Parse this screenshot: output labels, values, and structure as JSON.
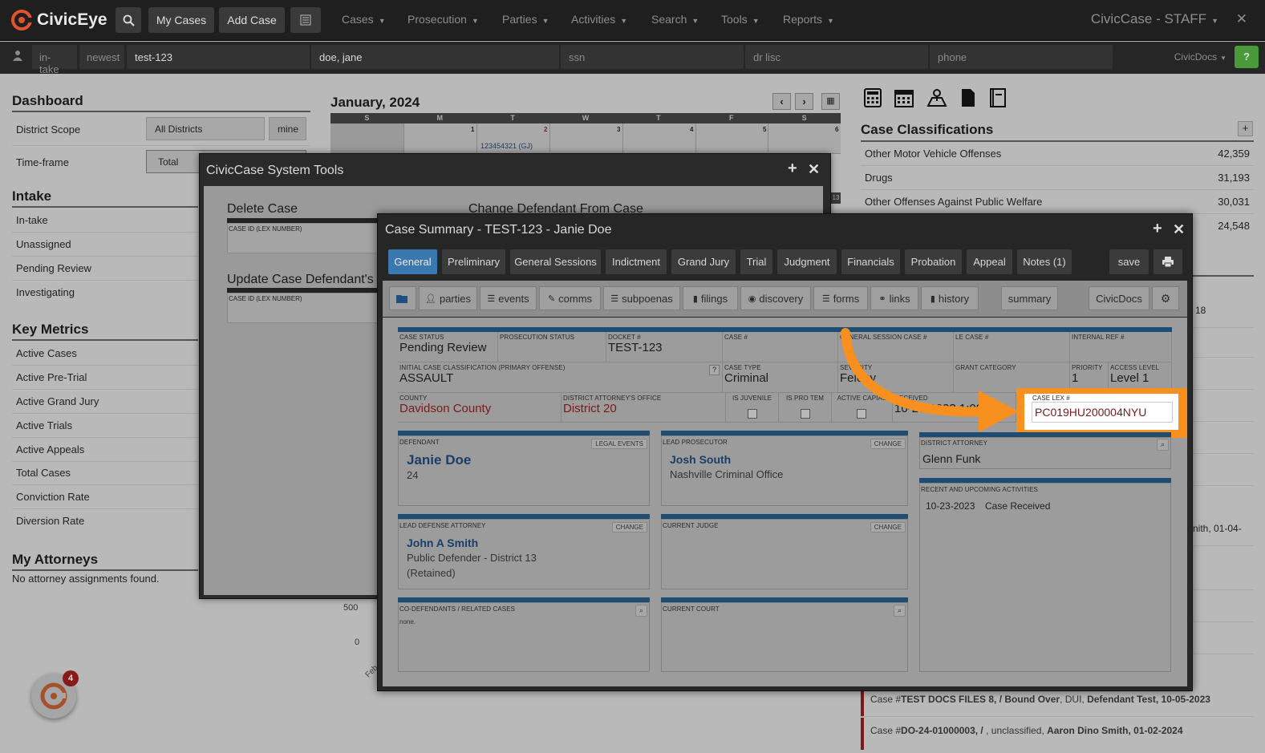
{
  "topnav": {
    "logo": "CivicEye",
    "my_cases": "My Cases",
    "add_case": "Add Case",
    "menus": [
      "Cases",
      "Prosecution",
      "Parties",
      "Activities",
      "Search",
      "Tools",
      "Reports"
    ],
    "brand": "CivicCase - STAFF",
    "close": "✕"
  },
  "searchbar": {
    "intake": "in-take",
    "newest": "newest",
    "case_value": "test-123",
    "name_value": "doe, jane",
    "ssn_placeholder": "ssn",
    "drlisc_placeholder": "dr lisc",
    "phone_placeholder": "phone",
    "civicdocs": "CivicDocs",
    "help": "?"
  },
  "dashboard": {
    "title": "Dashboard",
    "district_scope_label": "District Scope",
    "district_scope_value": "All Districts",
    "mine": "mine",
    "timeframe_label": "Time-frame",
    "timeframe_value": "Total",
    "intake_title": "Intake",
    "intake_items": [
      "In-take",
      "Unassigned",
      "Pending Review",
      "Investigating"
    ],
    "metrics_title": "Key Metrics",
    "metrics_items": [
      "Active Cases",
      "Active Pre-Trial",
      "Active Grand Jury",
      "Active Trials",
      "Active Appeals",
      "Total Cases",
      "Conviction Rate",
      "Diversion Rate"
    ],
    "attorneys_title": "My Attorneys",
    "attorneys_empty": "No attorney assignments found.",
    "notification_count": "4"
  },
  "calendar": {
    "month": "January, 2024",
    "days": [
      "S",
      "M",
      "T",
      "W",
      "T",
      "F",
      "S"
    ],
    "dates": [
      "1",
      "2",
      "3",
      "4",
      "5",
      "6"
    ],
    "event": "123454321 (GJ)",
    "side_date": "13",
    "chart_ticks": [
      "500",
      "0"
    ],
    "chart_xlabel": "Feb"
  },
  "classifications": {
    "title": "Case Classifications",
    "items": [
      {
        "label": "Other Motor Vehicle Offenses",
        "count": "42,359"
      },
      {
        "label": "Drugs",
        "count": "31,193"
      },
      {
        "label": "Other Offenses Against Public Welfare",
        "count": "30,031"
      },
      {
        "label": "",
        "count": "24,548"
      }
    ],
    "partial_number": "18",
    "partial_text": "nith, 01-04-"
  },
  "recent_cases": [
    {
      "prefix": "Case #",
      "id": "TEST DOCS FILES 8, / Bound Over",
      "middle": ", DUI, ",
      "name": "Defendant Test, 10-05-2023"
    },
    {
      "prefix": "Case #",
      "id": "DO-24-01000003, /",
      "middle": " , unclassified, ",
      "name": "Aaron Dino Smith, 01-02-2024"
    }
  ],
  "system_tools": {
    "title": "CivicCase System Tools",
    "delete_case": "Delete Case",
    "change_defendant": "Change Defendant From Case",
    "update_defendant": "Update Case Defendant's",
    "case_id_label": "CASE ID (LEX NUMBER)"
  },
  "case_summary": {
    "title": "Case Summary - TEST-123 - Janie Doe",
    "tabs": [
      "General",
      "Preliminary",
      "General Sessions",
      "Indictment",
      "Grand Jury",
      "Trial",
      "Judgment",
      "Financials",
      "Probation",
      "Appeal",
      "Notes (1)"
    ],
    "save": "save",
    "subtabs": [
      "parties",
      "events",
      "comms",
      "subpoenas",
      "filings",
      "discovery",
      "forms",
      "links",
      "history"
    ],
    "summary": "summary",
    "civicdocs": "CivicDocs",
    "fields": {
      "case_status_label": "CASE STATUS",
      "case_status": "Pending Review",
      "prosecution_status_label": "PROSECUTION STATUS",
      "docket_label": "DOCKET #",
      "docket": "TEST-123",
      "case_num_label": "CASE #",
      "general_session_label": "GENERAL SESSION CASE #",
      "le_case_label": "LE CASE #",
      "internal_ref_label": "INTERNAL REF #",
      "initial_class_label": "INITIAL CASE CLASSIFICATION (PRIMARY OFFENSE)",
      "initial_class": "ASSAULT",
      "help": "?",
      "case_type_label": "CASE TYPE",
      "case_type": "Criminal",
      "severity_label": "SEVERITY",
      "severity": "Felony",
      "grant_category_label": "GRANT CATEGORY",
      "priority_label": "PRIORITY",
      "priority": "1",
      "access_level_label": "ACCESS LEVEL",
      "access_level": "Level 1",
      "county_label": "COUNTY",
      "county": "Davidson County",
      "da_office_label": "DISTRICT ATTORNEY'S OFFICE",
      "da_office": "District 20",
      "is_juvenile_label": "IS JUVENILE",
      "is_pro_tem_label": "IS PRO TEM",
      "active_capias_label": "ACTIVE CAPIAS",
      "received_label": "RECEIVED",
      "received": "10-23-2023 1:00pm",
      "case_lex_label": "CASE LEX #",
      "case_lex": "PC019HU200004NYU"
    },
    "defendant": {
      "label": "DEFENDANT",
      "btn": "LEGAL EVENTS",
      "name": "Janie Doe",
      "age": "24"
    },
    "lead_prosecutor": {
      "label": "LEAD PROSECUTOR",
      "btn": "CHANGE",
      "name": "Josh South",
      "office": "Nashville Criminal Office"
    },
    "district_attorney": {
      "label": "DISTRICT ATTORNEY",
      "name": "Glenn Funk"
    },
    "defense": {
      "label": "LEAD DEFENSE ATTORNEY",
      "btn": "CHANGE",
      "name": "John A Smith",
      "office": "Public Defender - District 13",
      "note": "(Retained)"
    },
    "judge": {
      "label": "CURRENT JUDGE",
      "btn": "CHANGE"
    },
    "activities": {
      "label": "RECENT AND UPCOMING ACTIVITIES",
      "date": "10-23-2023",
      "text": "Case Received"
    },
    "codefendants": {
      "label": "CO-DEFENDANTS / RELATED CASES",
      "value": "none."
    },
    "court": {
      "label": "CURRENT COURT"
    }
  },
  "colors": {
    "accent": "#3a78b0",
    "highlight": "#f7901e",
    "header_bar": "#1e4c72",
    "link": "#1c3d6a"
  }
}
